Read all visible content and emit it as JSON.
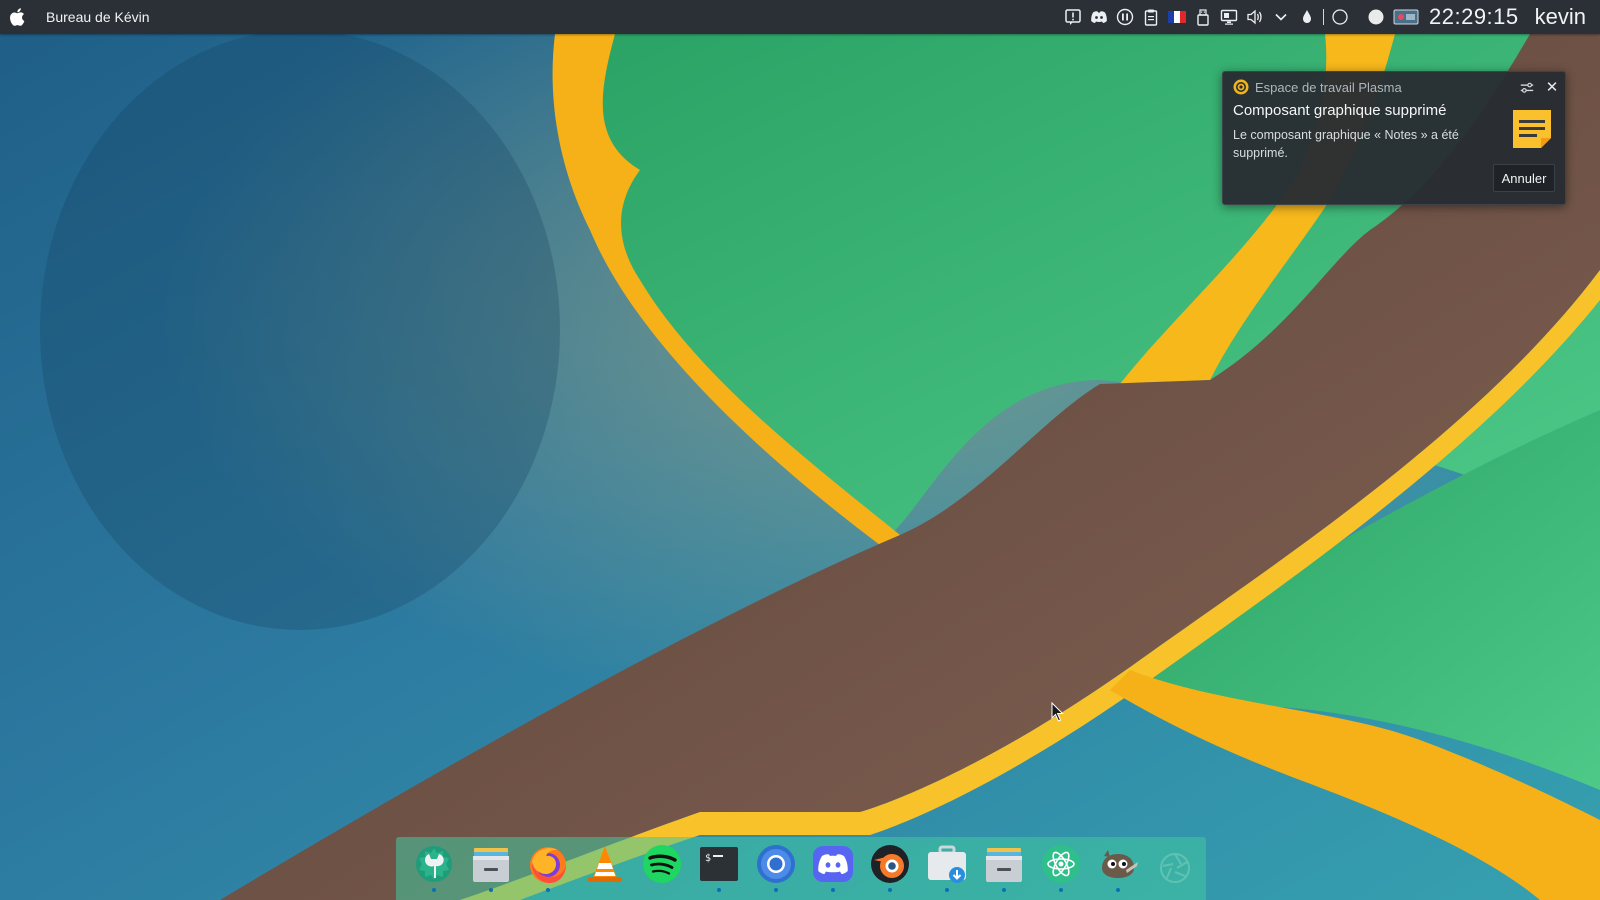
{
  "top_panel": {
    "window_title": "Bureau de Kévin",
    "tray_icons": [
      "notification-alert-icon",
      "discord-tray-icon",
      "media-controls-icon",
      "clipboard-icon",
      "french-flag-icon",
      "usb-device-icon",
      "display-icon",
      "volume-icon",
      "chevron-down-icon",
      "night-color-icon",
      "circle-outline-icon",
      "white-circle-icon",
      "screen-recorder-icon"
    ],
    "clock": "22:29:15",
    "user": "kevin"
  },
  "notification": {
    "app_name": "Espace de travail Plasma",
    "title": "Composant graphique supprimé",
    "body": "Le composant graphique « Notes » a été supprimé.",
    "action_label": "Annuler",
    "close_label": "✕"
  },
  "dock": {
    "items": [
      "system-settings-icon",
      "file-manager-icon",
      "firefox-icon",
      "vlc-icon",
      "spotify-icon",
      "terminal-icon",
      "chromium-icon",
      "discord-icon",
      "blender-icon",
      "software-center-icon",
      "archive-manager-icon",
      "atom-icon",
      "gimp-icon",
      "aperture-icon"
    ]
  },
  "colors": {
    "panel_bg": "#2b3036",
    "notification_bg": "#282d33",
    "dock_bg": "#42c8a0",
    "wallpaper_blue": "#2d7396",
    "wallpaper_green": "#3db074",
    "wallpaper_gold": "#f5b117",
    "wallpaper_brown": "#6b5046",
    "indicator_dot": "#0b6fb8"
  }
}
